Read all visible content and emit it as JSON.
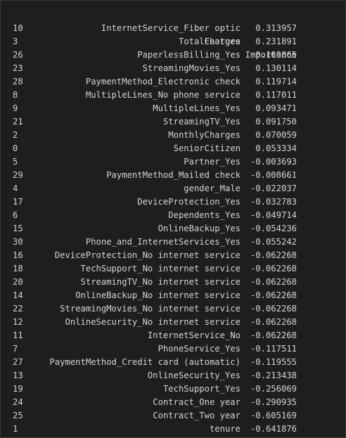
{
  "table": {
    "headers": {
      "index": "",
      "feature": "Feature",
      "importance": "Importance"
    },
    "rows": [
      {
        "index": "10",
        "feature": "InternetService_Fiber optic",
        "importance": "0.313957"
      },
      {
        "index": "3",
        "feature": "TotalCharges",
        "importance": "0.231891"
      },
      {
        "index": "26",
        "feature": "PaperlessBilling_Yes",
        "importance": "0.169865"
      },
      {
        "index": "23",
        "feature": "StreamingMovies_Yes",
        "importance": "0.130114"
      },
      {
        "index": "28",
        "feature": "PaymentMethod_Electronic check",
        "importance": "0.119714"
      },
      {
        "index": "8",
        "feature": "MultipleLines_No phone service",
        "importance": "0.117011"
      },
      {
        "index": "9",
        "feature": "MultipleLines_Yes",
        "importance": "0.093471"
      },
      {
        "index": "21",
        "feature": "StreamingTV_Yes",
        "importance": "0.091750"
      },
      {
        "index": "2",
        "feature": "MonthlyCharges",
        "importance": "0.070059"
      },
      {
        "index": "0",
        "feature": "SeniorCitizen",
        "importance": "0.053334"
      },
      {
        "index": "5",
        "feature": "Partner_Yes",
        "importance": "-0.003693"
      },
      {
        "index": "29",
        "feature": "PaymentMethod_Mailed check",
        "importance": "-0.008661"
      },
      {
        "index": "4",
        "feature": "gender_Male",
        "importance": "-0.022037"
      },
      {
        "index": "17",
        "feature": "DeviceProtection_Yes",
        "importance": "-0.032783"
      },
      {
        "index": "6",
        "feature": "Dependents_Yes",
        "importance": "-0.049714"
      },
      {
        "index": "15",
        "feature": "OnlineBackup_Yes",
        "importance": "-0.054236"
      },
      {
        "index": "30",
        "feature": "Phone_and_InternetServices_Yes",
        "importance": "-0.055242"
      },
      {
        "index": "16",
        "feature": "DeviceProtection_No internet service",
        "importance": "-0.062268"
      },
      {
        "index": "18",
        "feature": "TechSupport_No internet service",
        "importance": "-0.062268"
      },
      {
        "index": "20",
        "feature": "StreamingTV_No internet service",
        "importance": "-0.062268"
      },
      {
        "index": "14",
        "feature": "OnlineBackup_No internet service",
        "importance": "-0.062268"
      },
      {
        "index": "22",
        "feature": "StreamingMovies_No internet service",
        "importance": "-0.062268"
      },
      {
        "index": "12",
        "feature": "OnlineSecurity_No internet service",
        "importance": "-0.062268"
      },
      {
        "index": "11",
        "feature": "InternetService_No",
        "importance": "-0.062268"
      },
      {
        "index": "7",
        "feature": "PhoneService_Yes",
        "importance": "-0.117511"
      },
      {
        "index": "27",
        "feature": "PaymentMethod_Credit card (automatic)",
        "importance": "-0.119555"
      },
      {
        "index": "13",
        "feature": "OnlineSecurity_Yes",
        "importance": "-0.213438"
      },
      {
        "index": "19",
        "feature": "TechSupport_Yes",
        "importance": "-0.256069"
      },
      {
        "index": "24",
        "feature": "Contract_One year",
        "importance": "-0.290935"
      },
      {
        "index": "25",
        "feature": "Contract_Two year",
        "importance": "-0.605169"
      },
      {
        "index": "1",
        "feature": "tenure",
        "importance": "-0.641876"
      }
    ]
  },
  "colors": {
    "background": "#1e1e1e",
    "text": "#d4d4d4",
    "border": "#3a3a3a"
  }
}
